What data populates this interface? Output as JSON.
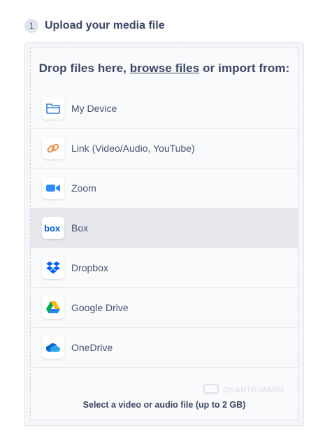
{
  "step": {
    "number": "1",
    "title": "Upload your media file"
  },
  "drop": {
    "prefix": "Drop files here,",
    "browse": "browse files",
    "suffix": "or import from:"
  },
  "sources": [
    {
      "label": "My Device",
      "icon": "folder-icon"
    },
    {
      "label": "Link (Video/Audio, YouTube)",
      "icon": "link-icon"
    },
    {
      "label": "Zoom",
      "icon": "zoom-icon"
    },
    {
      "label": "Box",
      "icon": "box-icon",
      "hovered": true
    },
    {
      "label": "Dropbox",
      "icon": "dropbox-icon"
    },
    {
      "label": "Google Drive",
      "icon": "google-drive-icon"
    },
    {
      "label": "OneDrive",
      "icon": "onedrive-icon"
    }
  ],
  "watermark": {
    "text": "QUANTRIMANG"
  },
  "footer": {
    "note": "Select a video or audio file (up to 2 GB)"
  },
  "colors": {
    "hover_row": "#e6e8ec",
    "panel_bg": "#f5f6f9",
    "text": "#3b4663"
  }
}
